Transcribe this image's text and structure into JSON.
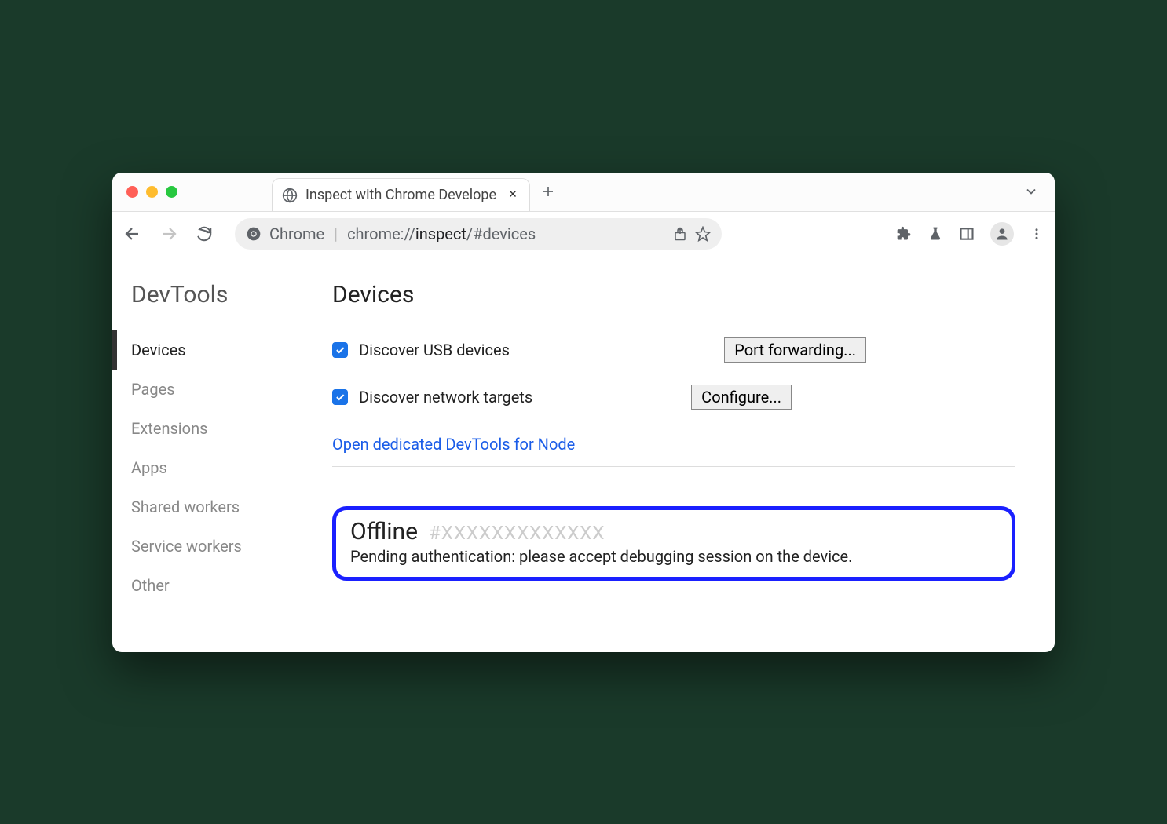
{
  "window": {
    "tab_title": "Inspect with Chrome Develope"
  },
  "omnibox": {
    "scheme_label": "Chrome",
    "url_prefix": "chrome://",
    "url_bold": "inspect",
    "url_suffix": "/#devices"
  },
  "sidebar": {
    "title": "DevTools",
    "items": [
      {
        "label": "Devices",
        "active": true
      },
      {
        "label": "Pages"
      },
      {
        "label": "Extensions"
      },
      {
        "label": "Apps"
      },
      {
        "label": "Shared workers"
      },
      {
        "label": "Service workers"
      },
      {
        "label": "Other"
      }
    ]
  },
  "main": {
    "heading": "Devices",
    "discover_usb_label": "Discover USB devices",
    "port_forwarding_btn": "Port forwarding...",
    "discover_network_label": "Discover network targets",
    "configure_btn": "Configure...",
    "node_link": "Open dedicated DevTools for Node",
    "offline": {
      "title": "Offline",
      "hash": "#XXXXXXXXXXXXX",
      "message": "Pending authentication: please accept debugging session on the device."
    }
  }
}
